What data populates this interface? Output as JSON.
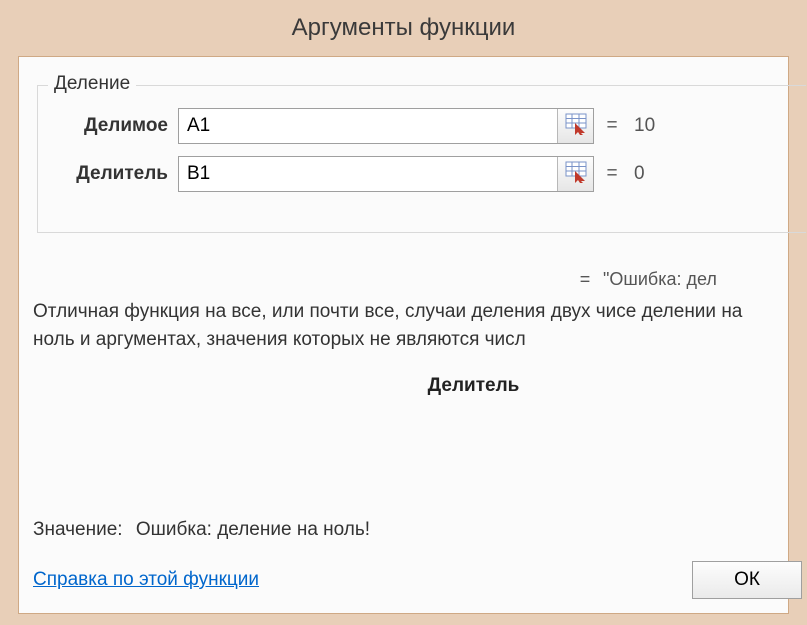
{
  "dialog": {
    "title": "Аргументы функции"
  },
  "group": {
    "legend": "Деление",
    "args": [
      {
        "label": "Делимое",
        "value": "A1",
        "result": "10"
      },
      {
        "label": "Делитель",
        "value": "B1",
        "result": "0"
      }
    ]
  },
  "preview": {
    "eq": "=",
    "result": "\"Ошибка: дел"
  },
  "description": "Отличная функция на все, или почти все, случаи деления двух чисе делении на ноль и аргументах, значения которых не являются числ",
  "current_arg_help": "Делитель",
  "value_line": {
    "label": "Значение:",
    "text": "Ошибка: деление на ноль!"
  },
  "help_link": "Справка по этой функции",
  "buttons": {
    "ok": "ОК"
  },
  "eq_sign": "="
}
